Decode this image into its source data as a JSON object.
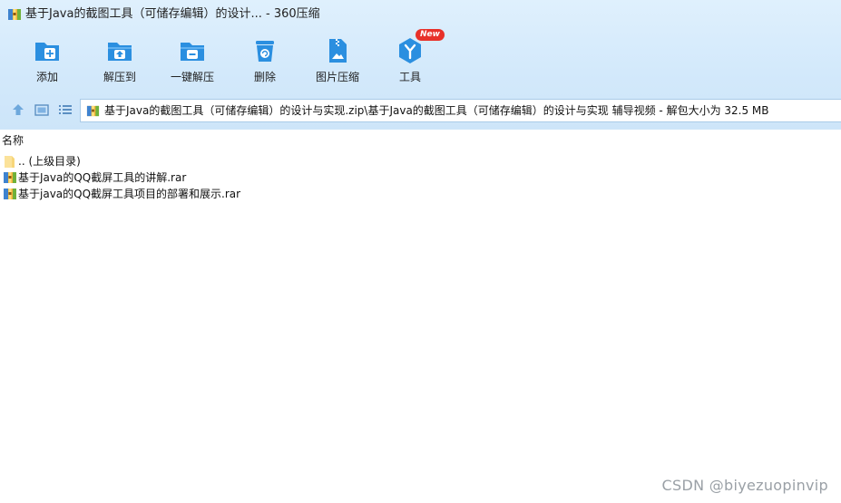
{
  "window": {
    "title": "基于Java的截图工具（可储存编辑）的设计... - 360压缩"
  },
  "toolbar": {
    "items": [
      {
        "label": "添加",
        "icon": "add-folder-icon"
      },
      {
        "label": "解压到",
        "icon": "extract-to-icon"
      },
      {
        "label": "一键解压",
        "icon": "one-click-extract-icon"
      },
      {
        "label": "删除",
        "icon": "delete-icon"
      },
      {
        "label": "图片压缩",
        "icon": "image-compress-icon"
      },
      {
        "label": "工具",
        "icon": "tools-icon",
        "badge": "New"
      }
    ]
  },
  "navbar": {
    "up_icon": "up-arrow-icon",
    "view_icon": "view-mode-icon",
    "list_icon": "list-view-icon",
    "address": "基于Java的截图工具（可储存编辑）的设计与实现.zip\\基于Java的截图工具（可储存编辑）的设计与实现   辅导视频 - 解包大小为 32.5 MB"
  },
  "file_list": {
    "column_name": "名称",
    "rows": [
      {
        "name": ".. (上级目录)",
        "icon": "folder-icon"
      },
      {
        "name": "基于Java的QQ截屏工具的讲解.rar",
        "icon": "archive-icon"
      },
      {
        "name": "基于java的QQ截屏工具项目的部署和展示.rar",
        "icon": "archive-icon"
      }
    ]
  },
  "watermark": "CSDN @biyezuopinvip",
  "colors": {
    "toolbar_bg": "#d3e9fb",
    "icon_blue": "#2b8fe0",
    "badge_red": "#e8312a"
  }
}
